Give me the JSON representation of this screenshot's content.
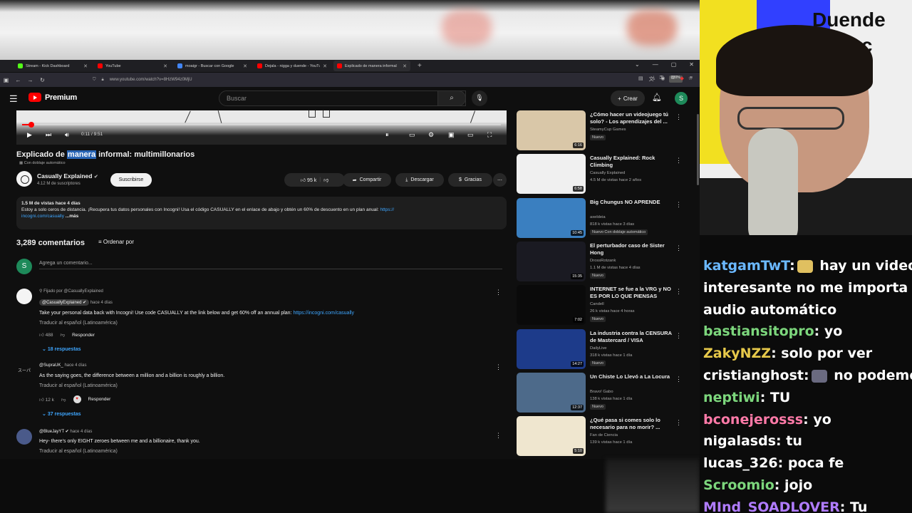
{
  "browser": {
    "tabs": [
      {
        "label": "Stream - Kick Dashboard",
        "color": "#53fc18",
        "active": false
      },
      {
        "label": "YouTube",
        "color": "#ff0000",
        "active": false
      },
      {
        "label": "moaigr - Buscar con Google",
        "color": "#4285f4",
        "active": false
      },
      {
        "label": "Dejala - nigga y duende - YouTu",
        "color": "#ff0000",
        "active": false
      },
      {
        "label": "Explicado de manera informal",
        "color": "#ff0000",
        "active": true
      }
    ],
    "url": "www.youtube.com/watch?v=8HzW94z0MjU",
    "zoom": "120%"
  },
  "header": {
    "logo": "Premium",
    "search_placeholder": "Buscar",
    "create_label": "Crear",
    "avatar_letter": "S"
  },
  "player": {
    "time": "0:11 / 9:51",
    "progress": 0.02
  },
  "video": {
    "title_pre": "Explicado de ",
    "title_hl": "manera",
    "title_post": " informal: multimillonarios",
    "dubbing": "Con doblaje automático",
    "channel": "Casually Explained",
    "subscribers": "4.12 M de suscriptores",
    "subscribe_label": "Suscribirse",
    "likes": "95 k",
    "share_label": "Compartir",
    "download_label": "Descargar",
    "thanks_label": "Gracias"
  },
  "description": {
    "stats": "1.5 M de vistas  hace 4 días",
    "text": "Estoy a solo ceros de distancia. ¡Recupera tus datos personales con Incogni! Usa el código CASUALLY en el enlace de abajo y obtén un 60% de descuento en un plan anual: ",
    "link1": "https://",
    "link2": "incogni.com/casually",
    "more": " ...más"
  },
  "comments": {
    "count": "3,289 comentarios",
    "sort_label": "Ordenar por",
    "add_placeholder": "Agrega un comentario...",
    "avatar_letter": "S",
    "items": [
      {
        "pinned": "Fijado por @CasuallyExplained",
        "author": "@CasuallyExplained",
        "time": "hace 4 días",
        "text": "Take your personal data back with Incogni! Use code CASUALLY at the link below and get 60% off an annual plan: ",
        "link": "https://incogni.com/casually",
        "translate": "Traducir al español (Latinoamérica)",
        "likes": "488",
        "reply": "Responder",
        "replies": "18 respuestas"
      },
      {
        "author": "@SupraUK_",
        "time": "hace 4 días",
        "text": "As the saying goes, the difference between a million and a billion is roughly a billion.",
        "translate": "Traducir al español (Latinoamérica)",
        "likes": "12 k",
        "reply": "Responder",
        "replies": "37 respuestas"
      },
      {
        "author": "@BlueJayYT",
        "time": "hace 4 días",
        "text": "Hey- there's only EIGHT zeroes between me and a billionaire, thank you.",
        "translate": "Traducir al español (Latinoamérica)"
      }
    ]
  },
  "sidebar": [
    {
      "title": "¿Cómo hacer un videojuego tú solo? - Los aprendizajes del ...",
      "channel": "SteamyCup Games",
      "views": "",
      "badge": "Nuevo",
      "duration": "6:16",
      "thumb": "#d9c7a8"
    },
    {
      "title": "Casually Explained: Rock Climbing",
      "channel": "Casually Explained",
      "views": "4.5 M de vistas  hace 2 años",
      "badge": "",
      "duration": "6:58",
      "thumb": "#f0f0f0"
    },
    {
      "title": "Big Chungus NO APRENDE",
      "channel": "axeldeia",
      "views": "818 k vistas  hace 3 días",
      "badge": "Nuevo   Con doblaje automático",
      "duration": "10:45",
      "thumb": "#3a7fc0"
    },
    {
      "title": "El perturbador caso de Sister Hong",
      "channel": "DrossRotzank",
      "views": "1.1 M de vistas  hace 4 días",
      "badge": "Nuevo",
      "duration": "15:35",
      "thumb": "#1a1a22"
    },
    {
      "title": "INTERNET se fue a la VRG y NO ES POR LO QUE PIENSAS",
      "channel": "Candell",
      "views": "26 k vistas  hace 4 horas",
      "badge": "Nuevo",
      "duration": "7:02",
      "thumb": "#0a0a0a"
    },
    {
      "title": "La industria contra la CENSURA de Mastercard / VISA",
      "channel": "DailyLive",
      "views": "318 k vistas  hace 1 día",
      "badge": "Nuevo",
      "duration": "14:27",
      "thumb": "#1d3b8a"
    },
    {
      "title": "Un Chiste Lo Llevó a La Locura",
      "channel": "Bravo! Gabo",
      "views": "138 k vistas  hace 1 día",
      "badge": "Nuevo",
      "duration": "12:37",
      "thumb": "#4d6a8a"
    },
    {
      "title": "¿Qué pasa si comes solo lo necesario para no morir? ...",
      "channel": "Fan de Ciencia",
      "views": "139 k vistas  hace 1 día",
      "badge": "",
      "duration": "5:10",
      "thumb": "#efe6cf"
    }
  ],
  "stream": {
    "sign_line1": "Duende",
    "sign_line2": "laac",
    "chat": [
      {
        "user": "katgamTwT",
        "color": "#6bb8ff",
        "msg": " hay un video",
        "emote": "#e0c060"
      },
      {
        "user": "",
        "color": "#ffffff",
        "msg": "interesante no me importa el"
      },
      {
        "user": "",
        "color": "#ffffff",
        "msg": "audio automático"
      },
      {
        "user": "bastiansitopro",
        "color": "#7cd67c",
        "msg": " yo"
      },
      {
        "user": "ZakyNZZ",
        "color": "#e6c84a",
        "msg": " solo por ver"
      },
      {
        "user": "cristianghost",
        "color": "#ffffff",
        "msg": " no podemos",
        "emote": "#6a6a80"
      },
      {
        "user": "neptiwi",
        "color": "#7cd67c",
        "msg": " TU"
      },
      {
        "user": "bconejerosss",
        "color": "#ff7aa8",
        "msg": " yo"
      },
      {
        "user": "nigalasds",
        "color": "#ffffff",
        "msg": " tu"
      },
      {
        "user": "lucas_326",
        "color": "#ffffff",
        "msg": " poca fe"
      },
      {
        "user": "Scroomio",
        "color": "#7cd67c",
        "msg": " jojo"
      },
      {
        "user": "MInd_SOADLOVER",
        "color": "#b07cff",
        "msg": " Tu"
      }
    ]
  }
}
